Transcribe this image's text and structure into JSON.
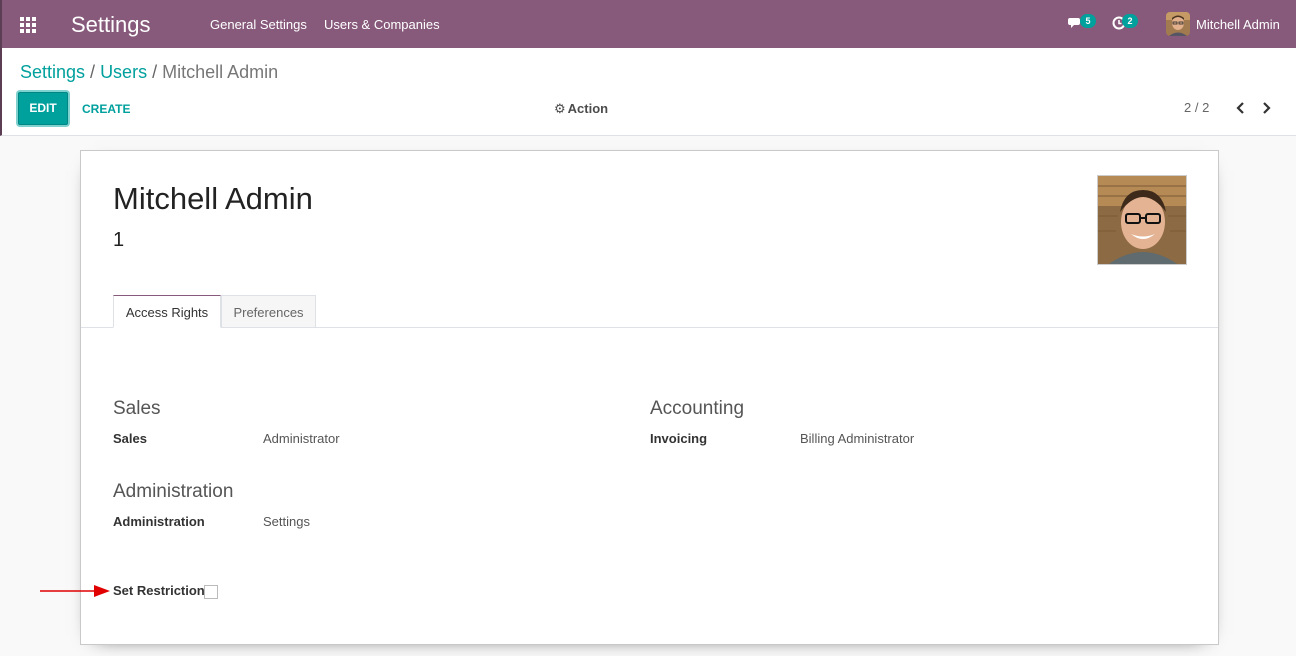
{
  "navbar": {
    "app_title": "Settings",
    "menus": [
      "General Settings",
      "Users & Companies"
    ],
    "messages_icon": "chat-icon",
    "messages_count": "5",
    "activities_icon": "clock-icon",
    "activities_count": "2",
    "user_name": "Mitchell Admin",
    "bg_color": "#875a7b"
  },
  "control_panel": {
    "breadcrumb": {
      "root": "Settings",
      "parent": "Users",
      "current": "Mitchell Admin",
      "separator": "/"
    },
    "edit_label": "EDIT",
    "create_label": "CREATE",
    "action_label": "Action",
    "pager": "2 / 2",
    "accent_color": "#00a09d"
  },
  "form": {
    "name": "Mitchell Admin",
    "sub_value": "1",
    "tabs": [
      {
        "label": "Access Rights",
        "active": true
      },
      {
        "label": "Preferences",
        "active": false
      }
    ],
    "groups": {
      "sales": {
        "title": "Sales",
        "field_label": "Sales",
        "field_value": "Administrator"
      },
      "accounting": {
        "title": "Accounting",
        "field_label": "Invoicing",
        "field_value": "Billing Administrator"
      },
      "administration": {
        "title": "Administration",
        "field_label": "Administration",
        "field_value": "Settings"
      }
    },
    "set_restriction": {
      "label": "Set Restriction",
      "checked": false
    }
  },
  "annotation": {
    "arrow_color": "#e00000"
  }
}
